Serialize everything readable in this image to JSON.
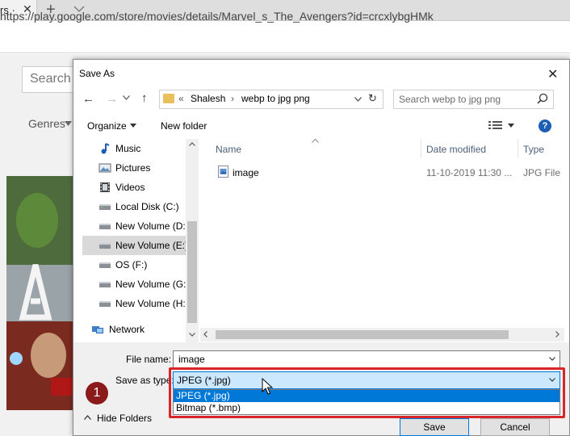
{
  "browser": {
    "tab_title": "rs ·",
    "url": "https://play.google.com/store/movies/details/Marvel_s_The_Avengers?id=crcxlybgHMk",
    "site_search_placeholder": "Search",
    "genres_label": "Genres"
  },
  "dialog": {
    "title": "Save As",
    "breadcrumb": {
      "overflow": "«",
      "segments": [
        "Shalesh",
        "webp to jpg png"
      ]
    },
    "search_placeholder": "Search webp to jpg png",
    "toolbar": {
      "organize_label": "Organize",
      "new_folder_label": "New folder",
      "help_label": "?"
    },
    "nav_items": [
      {
        "label": "Music",
        "icon": "music-icon"
      },
      {
        "label": "Pictures",
        "icon": "pictures-icon"
      },
      {
        "label": "Videos",
        "icon": "videos-icon"
      },
      {
        "label": "Local Disk (C:)",
        "icon": "drive-icon"
      },
      {
        "label": "New Volume (D:)",
        "icon": "drive-icon"
      },
      {
        "label": "New Volume (E:)",
        "icon": "drive-icon",
        "selected": true
      },
      {
        "label": "OS (F:)",
        "icon": "drive-icon"
      },
      {
        "label": "New Volume (G:)",
        "icon": "drive-icon"
      },
      {
        "label": "New Volume (H:)",
        "icon": "drive-icon"
      },
      {
        "label": "Network",
        "icon": "network-icon"
      }
    ],
    "columns": {
      "name": "Name",
      "date": "Date modified",
      "type": "Type"
    },
    "files": [
      {
        "name": "image",
        "date": "11-10-2019 11:30 ...",
        "type": "JPG File"
      }
    ],
    "file_name_label": "File name:",
    "file_name_value": "image",
    "save_type_label": "Save as type:",
    "save_type_value": "JPEG (*.jpg)",
    "save_type_options": [
      "JPEG (*.jpg)",
      "Bitmap (*.bmp)"
    ],
    "hide_folders_label": "Hide Folders",
    "save_label": "Save",
    "cancel_label": "Cancel"
  },
  "annotation": {
    "step": "1",
    "highlight_color": "#d9252a"
  },
  "colors": {
    "accent": "#0078d7",
    "selection": "#cce8ff",
    "nav_selected": "#d9d9d9"
  }
}
